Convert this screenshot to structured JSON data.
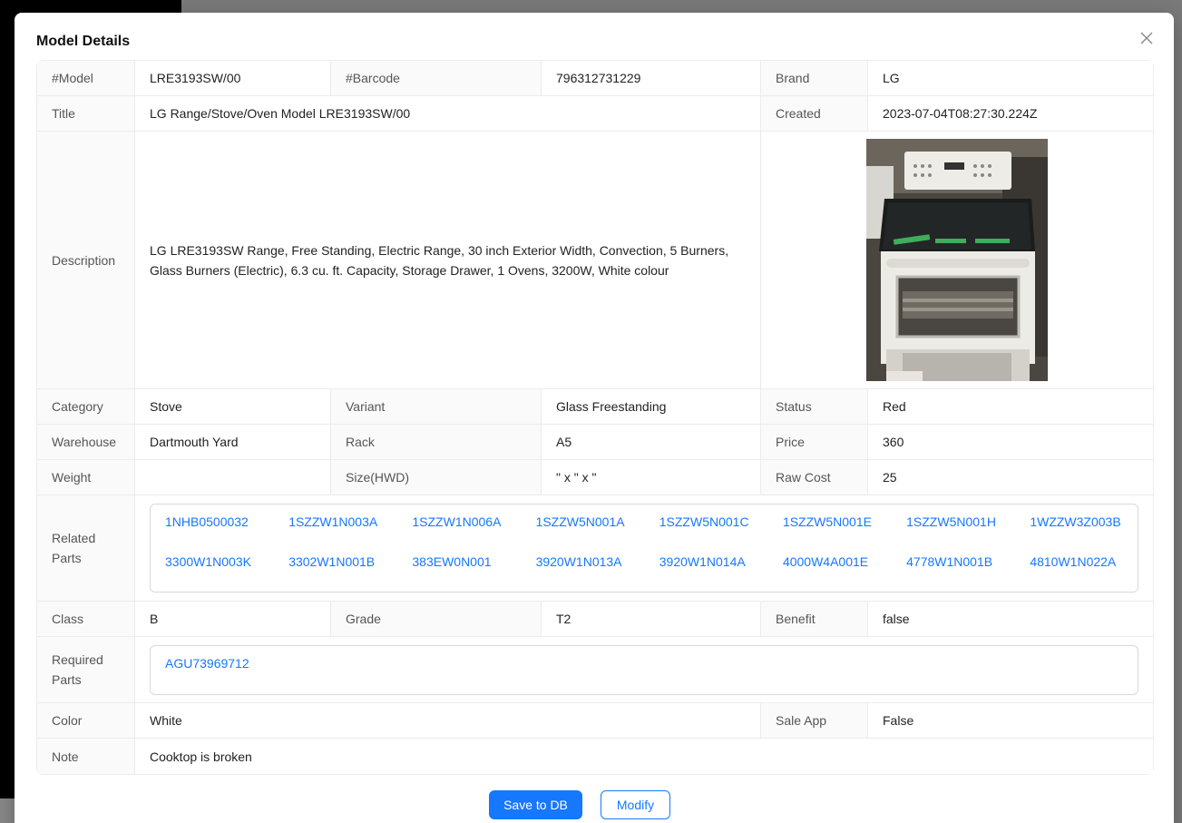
{
  "modal": {
    "title": "Model Details"
  },
  "rows": {
    "model_label": "#Model",
    "model_value": "LRE3193SW/00",
    "barcode_label": "#Barcode",
    "barcode_value": "796312731229",
    "brand_label": "Brand",
    "brand_value": "LG",
    "title_label": "Title",
    "title_value": "LG Range/Stove/Oven Model LRE3193SW/00",
    "created_label": "Created",
    "created_value": "2023-07-04T08:27:30.224Z",
    "description_label": "Description",
    "description_value": "LG LRE3193SW Range, Free Standing, Electric Range, 30 inch Exterior Width, Convection, 5 Burners, Glass Burners (Electric), 6.3 cu. ft. Capacity, Storage Drawer, 1 Ovens, 3200W, White colour",
    "category_label": "Category",
    "category_value": "Stove",
    "variant_label": "Variant",
    "variant_value": "Glass Freestanding",
    "status_label": "Status",
    "status_value": "Red",
    "warehouse_label": "Warehouse",
    "warehouse_value": "Dartmouth Yard",
    "rack_label": "Rack",
    "rack_value": "A5",
    "price_label": "Price",
    "price_value": "360",
    "weight_label": "Weight",
    "weight_value": "",
    "size_label": "Size(HWD)",
    "size_value": "\" x \" x \"",
    "raw_cost_label": "Raw Cost",
    "raw_cost_value": "25",
    "related_parts_label": "Related Parts",
    "class_label": "Class",
    "class_value": "B",
    "grade_label": "Grade",
    "grade_value": "T2",
    "benefit_label": "Benefit",
    "benefit_value": "false",
    "required_parts_label": "Required Parts",
    "color_label": "Color",
    "color_value": "White",
    "sale_app_label": "Sale App",
    "sale_app_value": "False",
    "note_label": "Note",
    "note_value": "Cooktop is broken"
  },
  "related_parts": [
    "1NHB0500032",
    "1SZZW1N003A",
    "1SZZW1N006A",
    "1SZZW5N001A",
    "1SZZW5N001C",
    "1SZZW5N001E",
    "1SZZW5N001H",
    "1WZZW3Z003B",
    "3300W1N003K",
    "3302W1N001B",
    "383EW0N001",
    "3920W1N013A",
    "3920W1N014A",
    "4000W4A001E",
    "4778W1N001B",
    "4810W1N022A"
  ],
  "required_parts": [
    "AGU73969712"
  ],
  "buttons": {
    "save": "Save to DB",
    "modify": "Modify"
  },
  "colors": {
    "accent": "#1677ff",
    "label_bg": "#fafafa",
    "border": "#ececec"
  },
  "icons": {
    "close": "close-icon",
    "product_image": "stove-image"
  }
}
